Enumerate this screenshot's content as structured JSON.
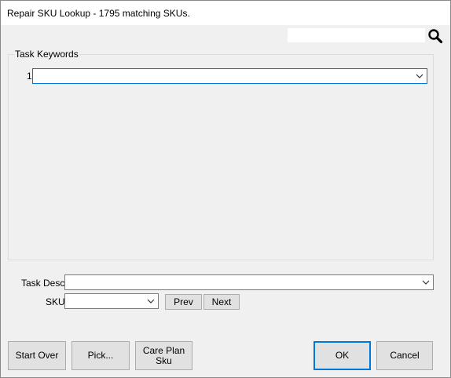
{
  "window": {
    "title": "Repair SKU Lookup - 1795 matching SKUs."
  },
  "search": {
    "value": "",
    "icon": "search-icon"
  },
  "task_keywords": {
    "group_label": "Task Keywords",
    "rows": [
      {
        "number": "1",
        "value": ""
      }
    ]
  },
  "fields": {
    "task_desc_label": "Task Desc",
    "task_desc_value": "",
    "sku_label": "SKU",
    "sku_value": ""
  },
  "nav": {
    "prev_label": "Prev",
    "next_label": "Next"
  },
  "buttons": {
    "start_over": "Start Over",
    "pick": "Pick...",
    "care_plan_line1": "Care Plan",
    "care_plan_line2": "Sku",
    "ok": "OK",
    "cancel": "Cancel"
  }
}
